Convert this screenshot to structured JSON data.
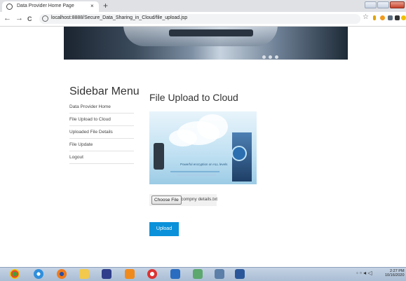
{
  "browser": {
    "tab_title": "Data Provider Home Page",
    "tab_close": "×",
    "new_tab": "+",
    "back": "←",
    "forward": "→",
    "reload": "C",
    "url": "localhost:8888/Secure_Data_Sharing_in_Cloud/file_upload.jsp",
    "bookmark": "☆"
  },
  "sidebar": {
    "title": "Sidebar Menu",
    "items": [
      {
        "label": "Data Provider Home"
      },
      {
        "label": "File Upload to Cloud"
      },
      {
        "label": "Uploaded File Details"
      },
      {
        "label": "File Update"
      },
      {
        "label": "Logout"
      }
    ]
  },
  "main": {
    "title": "File Upload to Cloud",
    "image_caption": "Powerful encryption on ALL levels",
    "choose_file_label": "Choose File",
    "selected_file": "compny details.txt",
    "upload_label": "Upload"
  },
  "taskbar": {
    "time": "2:27 PM",
    "date": "10/16/2020",
    "icons": [
      "chrome-icon",
      "ie-icon",
      "firefox-icon",
      "explorer-icon",
      "media-player-icon",
      "vlc-icon",
      "opera-icon",
      "virtualbox-icon",
      "tool-icon",
      "app-icon",
      "word-icon"
    ]
  },
  "colors": {
    "upload_button": "#0a91d9",
    "tab_bar": "#dfe1e5",
    "taskbar": "#b4c6dc"
  }
}
